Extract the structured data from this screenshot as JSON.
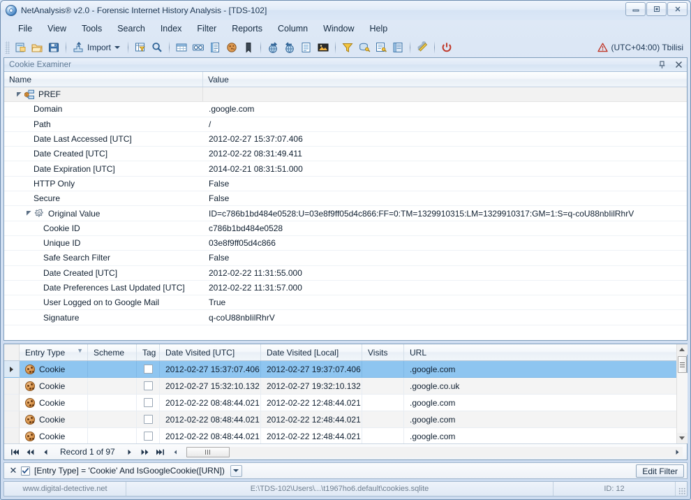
{
  "window": {
    "title": "NetAnalysis® v2.0 - Forensic Internet History Analysis - [TDS-102]",
    "minimize": "—",
    "maximize": "❐",
    "close": "✕"
  },
  "menu": {
    "items": [
      "File",
      "View",
      "Tools",
      "Search",
      "Index",
      "Filter",
      "Reports",
      "Column",
      "Window",
      "Help"
    ]
  },
  "toolbar": {
    "import_label": "Import",
    "timezone": "(UTC+04:00) Tbilisi",
    "buttons": [
      "new-case-icon",
      "open-case-icon",
      "save-icon",
      "import-icon",
      "filter-grid-icon",
      "search-icon",
      "grid-view-icon",
      "cache-view-icon",
      "report-view-icon",
      "cookie-view-icon",
      "bookmark-icon",
      "export-next-icon",
      "export-back-icon",
      "list-detail-icon",
      "image-preview-icon",
      "filter-icon",
      "decode-key-icon",
      "decode-list-icon",
      "index-book-icon",
      "tools-icon",
      "power-icon"
    ]
  },
  "examiner": {
    "title": "Cookie Examiner",
    "pin_icon": "pin-icon",
    "close_icon": "close-icon",
    "columns": [
      "Name",
      "Value"
    ],
    "rows": [
      {
        "level": 0,
        "expander": "expanded",
        "icon": "cookie-node-icon",
        "name": "PREF",
        "value": "",
        "group": true
      },
      {
        "level": 1,
        "expander": "none",
        "icon": "",
        "name": "Domain",
        "value": ".google.com"
      },
      {
        "level": 1,
        "expander": "none",
        "icon": "",
        "name": "Path",
        "value": "/"
      },
      {
        "level": 1,
        "expander": "none",
        "icon": "",
        "name": "Date Last Accessed [UTC]",
        "value": "2012-02-27 15:37:07.406"
      },
      {
        "level": 1,
        "expander": "none",
        "icon": "",
        "name": "Date Created [UTC]",
        "value": "2012-02-22 08:31:49.411"
      },
      {
        "level": 1,
        "expander": "none",
        "icon": "",
        "name": "Date Expiration [UTC]",
        "value": "2014-02-21 08:31:51.000"
      },
      {
        "level": 1,
        "expander": "none",
        "icon": "",
        "name": "HTTP Only",
        "value": "False"
      },
      {
        "level": 1,
        "expander": "none",
        "icon": "",
        "name": "Secure",
        "value": "False"
      },
      {
        "level": 1,
        "expander": "expanded",
        "icon": "gear-icon",
        "name": "Original Value",
        "value": "ID=c786b1bd484e0528:U=03e8f9ff05d4c866:FF=0:TM=1329910315:LM=1329910317:GM=1:S=q-coU88nbIilRhrV"
      },
      {
        "level": 2,
        "expander": "none",
        "icon": "",
        "name": "Cookie ID",
        "value": "c786b1bd484e0528"
      },
      {
        "level": 2,
        "expander": "none",
        "icon": "",
        "name": "Unique ID",
        "value": "03e8f9ff05d4c866"
      },
      {
        "level": 2,
        "expander": "none",
        "icon": "",
        "name": "Safe Search Filter",
        "value": "False"
      },
      {
        "level": 2,
        "expander": "none",
        "icon": "",
        "name": "Date Created [UTC]",
        "value": "2012-02-22 11:31:55.000"
      },
      {
        "level": 2,
        "expander": "none",
        "icon": "",
        "name": "Date Preferences Last Updated [UTC]",
        "value": "2012-02-22 11:31:57.000"
      },
      {
        "level": 2,
        "expander": "none",
        "icon": "",
        "name": "User Logged on to Google Mail",
        "value": "True"
      },
      {
        "level": 2,
        "expander": "none",
        "icon": "",
        "name": "Signature",
        "value": "q-coU88nbIilRhrV"
      }
    ]
  },
  "grid": {
    "columns": [
      {
        "key": "entry",
        "label": "Entry Type",
        "filtered": true
      },
      {
        "key": "scheme",
        "label": "Scheme",
        "filtered": false
      },
      {
        "key": "tag",
        "label": "Tag",
        "filtered": false
      },
      {
        "key": "dvu",
        "label": "Date Visited [UTC]",
        "filtered": false
      },
      {
        "key": "dvl",
        "label": "Date Visited [Local]",
        "filtered": false
      },
      {
        "key": "visits",
        "label": "Visits",
        "filtered": false
      },
      {
        "key": "url",
        "label": "URL",
        "filtered": false
      }
    ],
    "rows": [
      {
        "selected": true,
        "current": true,
        "entry": "Cookie",
        "scheme": "",
        "tag": false,
        "dvu": "2012-02-27 15:37:07.406",
        "dvl": "2012-02-27 19:37:07.406",
        "visits": "",
        "url": ".google.com"
      },
      {
        "selected": false,
        "current": false,
        "entry": "Cookie",
        "scheme": "",
        "tag": false,
        "dvu": "2012-02-27 15:32:10.132",
        "dvl": "2012-02-27 19:32:10.132",
        "visits": "",
        "url": ".google.co.uk"
      },
      {
        "selected": false,
        "current": false,
        "entry": "Cookie",
        "scheme": "",
        "tag": false,
        "dvu": "2012-02-22 08:48:44.021",
        "dvl": "2012-02-22 12:48:44.021",
        "visits": "",
        "url": ".google.com"
      },
      {
        "selected": false,
        "current": false,
        "entry": "Cookie",
        "scheme": "",
        "tag": false,
        "dvu": "2012-02-22 08:48:44.021",
        "dvl": "2012-02-22 12:48:44.021",
        "visits": "",
        "url": ".google.com"
      },
      {
        "selected": false,
        "current": false,
        "entry": "Cookie",
        "scheme": "",
        "tag": false,
        "dvu": "2012-02-22 08:48:44.021",
        "dvl": "2012-02-22 12:48:44.021",
        "visits": "",
        "url": ".google.com"
      }
    ],
    "navigation": {
      "record_label": "Record 1 of 97",
      "first": "first-record-icon",
      "prev_page": "previous-page-icon",
      "prev": "previous-record-icon",
      "next": "next-record-icon",
      "next_page": "next-page-icon",
      "last": "last-record-icon"
    }
  },
  "filter_bar": {
    "close_label": "✕",
    "enabled": true,
    "expression": "[Entry Type] = 'Cookie' And IsGoogleCookie([URN])",
    "edit_filter_label": "Edit Filter"
  },
  "status_bar": {
    "brand": "www.digital-detective.net",
    "path": "E:\\TDS-102\\Users\\...\\t1967ho6.default\\cookies.sqlite",
    "id": "ID: 12"
  },
  "colors": {
    "selection": "#8ec5f0",
    "frame": "#6d8cb0",
    "accent": "#2e5f94",
    "warning": "#c0392b"
  }
}
